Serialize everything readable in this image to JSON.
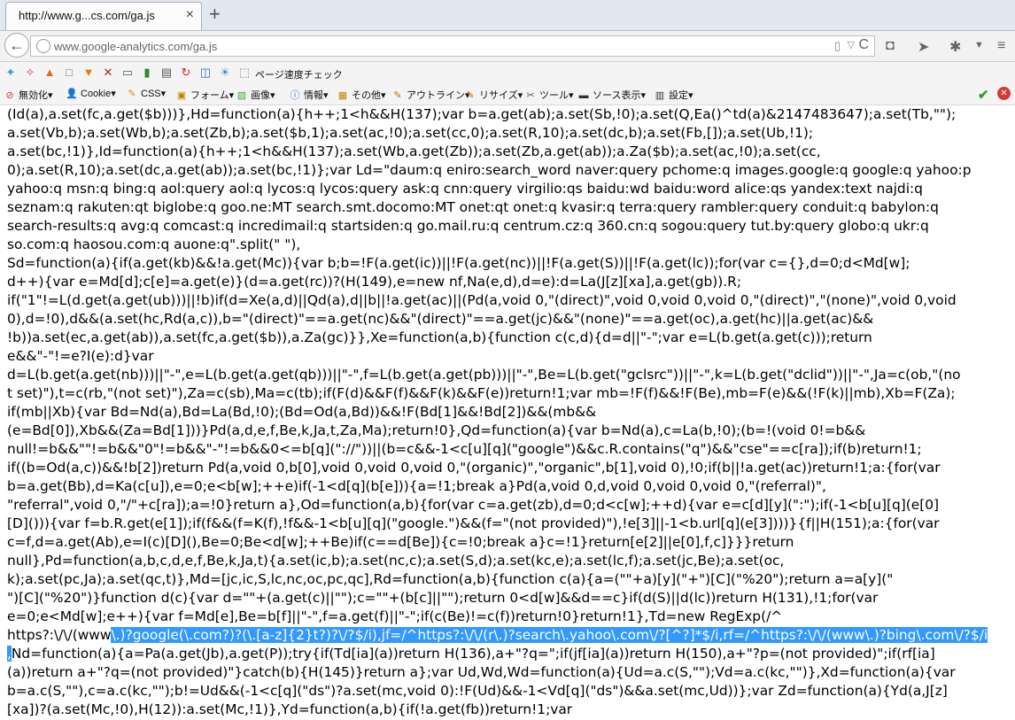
{
  "tab": {
    "title": "http://www.g...cs.com/ga.js",
    "close_glyph": "×",
    "new_tab_glyph": "+"
  },
  "nav": {
    "url": "www.google-analytics.com/ga.js",
    "back_glyph": "←",
    "reload_glyph": "C",
    "dropdown_glyph": "▽",
    "reader_glyph": "▯"
  },
  "bookmarks": {
    "page_speed_label": "ページ速度チェック"
  },
  "devbar": {
    "items": [
      {
        "label": "無効化▾",
        "icon": "no-entry-icon"
      },
      {
        "label": "Cookie▾",
        "icon": "user-icon"
      },
      {
        "label": "CSS▾",
        "icon": "pencil-icon"
      },
      {
        "label": "フォーム▾",
        "icon": "form-icon"
      },
      {
        "label": "画像▾",
        "icon": "image-icon"
      },
      {
        "label": "情報▾",
        "icon": "info-icon"
      },
      {
        "label": "その他▾",
        "icon": "misc-icon"
      },
      {
        "label": "アウトライン▾",
        "icon": "outline-icon"
      },
      {
        "label": "リサイズ▾",
        "icon": "resize-icon"
      },
      {
        "label": "ツール▾",
        "icon": "tools-icon"
      },
      {
        "label": "ソース表示▾",
        "icon": "source-icon"
      },
      {
        "label": "設定▾",
        "icon": "settings-icon"
      }
    ]
  },
  "code": {
    "lines": [
      "(Id(a),a.set(fc,a.get($b)))},Hd=function(a){h++;1<h&&H(137);var b=a.get(ab);a.set(Sb,!0);a.set(Q,Ea()^td(a)&2147483647);a.set(Tb,\"\");",
      "a.set(Vb,b);a.set(Wb,b);a.set(Zb,b);a.set($b,1);a.set(ac,!0);a.set(cc,0);a.set(R,10);a.set(dc,b);a.set(Fb,[]);a.set(Ub,!1);",
      "a.set(bc,!1)},Id=function(a){h++;1<h&&H(137);a.set(Wb,a.get(Zb));a.set(Zb,a.get(ab));a.Za($b);a.set(ac,!0);a.set(cc,",
      "0);a.set(R,10);a.set(dc,a.get(ab));a.set(bc,!1)};var Ld=\"daum:q eniro:search_word naver:query pchome:q images.google:q google:q yahoo:p",
      "yahoo:q msn:q bing:q aol:query aol:q lycos:q lycos:query ask:q cnn:query virgilio:qs baidu:wd baidu:word alice:qs yandex:text najdi:q",
      "seznam:q rakuten:qt biglobe:q goo.ne:MT search.smt.docomo:MT onet:qt onet:q kvasir:q terra:query rambler:query conduit:q babylon:q",
      "search-results:q avg:q comcast:q incredimail:q startsiden:q go.mail.ru:q centrum.cz:q 360.cn:q sogou:query tut.by:query globo:q ukr:q",
      "so.com:q haosou.com:q auone:q\".split(\" \"),",
      "Sd=function(a){if(a.get(kb)&&!a.get(Mc)){var b;b=!F(a.get(ic))||!F(a.get(nc))||!F(a.get(S))||!F(a.get(lc));for(var c={},d=0;d<Md[w];",
      "d++){var e=Md[d];c[e]=a.get(e)}(d=a.get(rc))?(H(149),e=new nf,Na(e,d),d=e):d=La(J[z][xa],a.get(gb)).R;",
      "if(\"1\"!=L(d.get(a.get(ub)))||!b)if(d=Xe(a,d)||Qd(a),d||b||!a.get(ac)||(Pd(a,void 0,\"(direct)\",void 0,void 0,void 0,\"(direct)\",\"(none)\",void 0,void",
      "0),d=!0),d&&(a.set(hc,Rd(a,c)),b=\"(direct)\"==a.get(nc)&&\"(direct)\"==a.get(jc)&&\"(none)\"==a.get(oc),a.get(hc)||a.get(ac)&&",
      "!b))a.set(ec,a.get(ab)),a.set(fc,a.get($b)),a.Za(gc)}},Xe=function(a,b){function c(c,d){d=d||\"-\";var e=L(b.get(a.get(c)));return",
      "e&&\"-\"!=e?I(e):d}var",
      "d=L(b.get(a.get(nb)))||\"-\",e=L(b.get(a.get(qb)))||\"-\",f=L(b.get(a.get(pb)))||\"-\",Be=L(b.get(\"gclsrc\"))||\"-\",k=L(b.get(\"dclid\"))||\"-\",Ja=c(ob,\"(no",
      "t set)\"),t=c(rb,\"(not set)\"),Za=c(sb),Ma=c(tb);if(F(d)&&F(f)&&F(k)&&F(e))return!1;var mb=!F(f)&&!F(Be),mb=F(e)&&(!F(k)||mb),Xb=F(Za);",
      "if(mb||Xb){var Bd=Nd(a),Bd=La(Bd,!0);(Bd=Od(a,Bd))&&!F(Bd[1]&&!Bd[2])&&(mb&&",
      "(e=Bd[0]),Xb&&(Za=Bd[1]))}Pd(a,d,e,f,Be,k,Ja,t,Za,Ma);return!0},Qd=function(a){var b=Nd(a),c=La(b,!0);(b=!(void 0!=b&&",
      "null!=b&&\"\"!=b&&\"0\"!=b&&\"-\"!=b&&0<=b[q](\"://\"))||(b=c&&-1<c[u][q](\"google\")&&c.R.contains(\"q\")&&\"cse\"==c[ra]);if(b)return!1;",
      "if((b=Od(a,c))&&!b[2])return Pd(a,void 0,b[0],void 0,void 0,void 0,\"(organic)\",\"organic\",b[1],void 0),!0;if(b||!a.get(ac))return!1;a:{for(var",
      "b=a.get(Bb),d=Ka(c[u]),e=0;e<b[w];++e)if(-1<d[q](b[e])){a=!1;break a}Pd(a,void 0,d,void 0,void 0,void 0,\"(referral)\",",
      "\"referral\",void 0,\"/\"+c[ra]);a=!0}return a},Od=function(a,b){for(var c=a.get(zb),d=0;d<c[w];++d){var e=c[d][y](\":\");if(-1<b[u][q](e[0]",
      "[D]())){var f=b.R.get(e[1]);if(f&&(f=K(f),!f&&-1<b[u][q](\"google.\")&&(f=\"(not provided)\"),!e[3]||-1<b.url[q](e[3])))}{f||H(151);a:{for(var",
      "c=f,d=a.get(Ab),e=I(c)[D](),Be=0;Be<d[w];++Be)if(c==d[Be]){c=!0;break a}c=!1}return[e[2]||e[0],f,c]}}}return",
      "null},Pd=function(a,b,c,d,e,f,Be,k,Ja,t){a.set(ic,b);a.set(nc,c);a.set(S,d);a.set(kc,e);a.set(lc,f);a.set(jc,Be);a.set(oc,",
      "k);a.set(pc,Ja);a.set(qc,t)},Md=[jc,ic,S,lc,nc,oc,pc,qc],Rd=function(a,b){function c(a){a=(\"\"+a)[y](\"+\")[C](\"%20\");return a=a[y](\"",
      "\")[C](\"%20\")}function d(c){var d=\"\"+(a.get(c)||\"\");c=\"\"+(b[c]||\"\");return 0<d[w]&&d==c}if(d(S)||d(lc))return H(131),!1;for(var",
      "e=0;e<Md[w];e++){var f=Md[e],Be=b[f]||\"-\",f=a.get(f)||\"-\";if(c(Be)!=c(f))return!0}return!1},Td=new RegExp(/^",
      "https?:\\/\\/(www",
      "\\.)?google(\\.com?)?(\\.[a-z]{2}t?)?\\/?$/i),jf=/^https?:\\/\\/(r\\.)?search\\.yahoo\\.com\\/?[^?]*$/i,rf=/^https?:\\/\\/(www\\.)?bing\\.com\\/?$/i",
      ",",
      "Nd=function(a){a=Pa(a.get(Jb),a.get(P));try{if(Td[ia](a))return H(136),a+\"?q=\";if(jf[ia](a))return H(150),a+\"?p=(not provided)\";if(rf[ia]",
      "(a))return a+\"?q=(not provided)\"}catch(b){H(145)}return a};var Ud,Wd,Wd=function(a){Ud=a.c(S,\"\");Vd=a.c(kc,\"\")},Xd=function(a){var",
      "b=a.c(S,\"\"),c=a.c(kc,\"\");b!=Ud&&(-1<c[q](\"ds\")?a.set(mc,void 0):!F(Ud)&&-1<Vd[q](\"ds\")&&a.set(mc,Ud))};var Zd=function(a){Yd(a,J[z]",
      "[xa])?(a.set(Mc,!0),H(12)):a.set(Mc,!1)},Yd=function(a,b){if(!a.get(fb))return!1;var"
    ]
  }
}
